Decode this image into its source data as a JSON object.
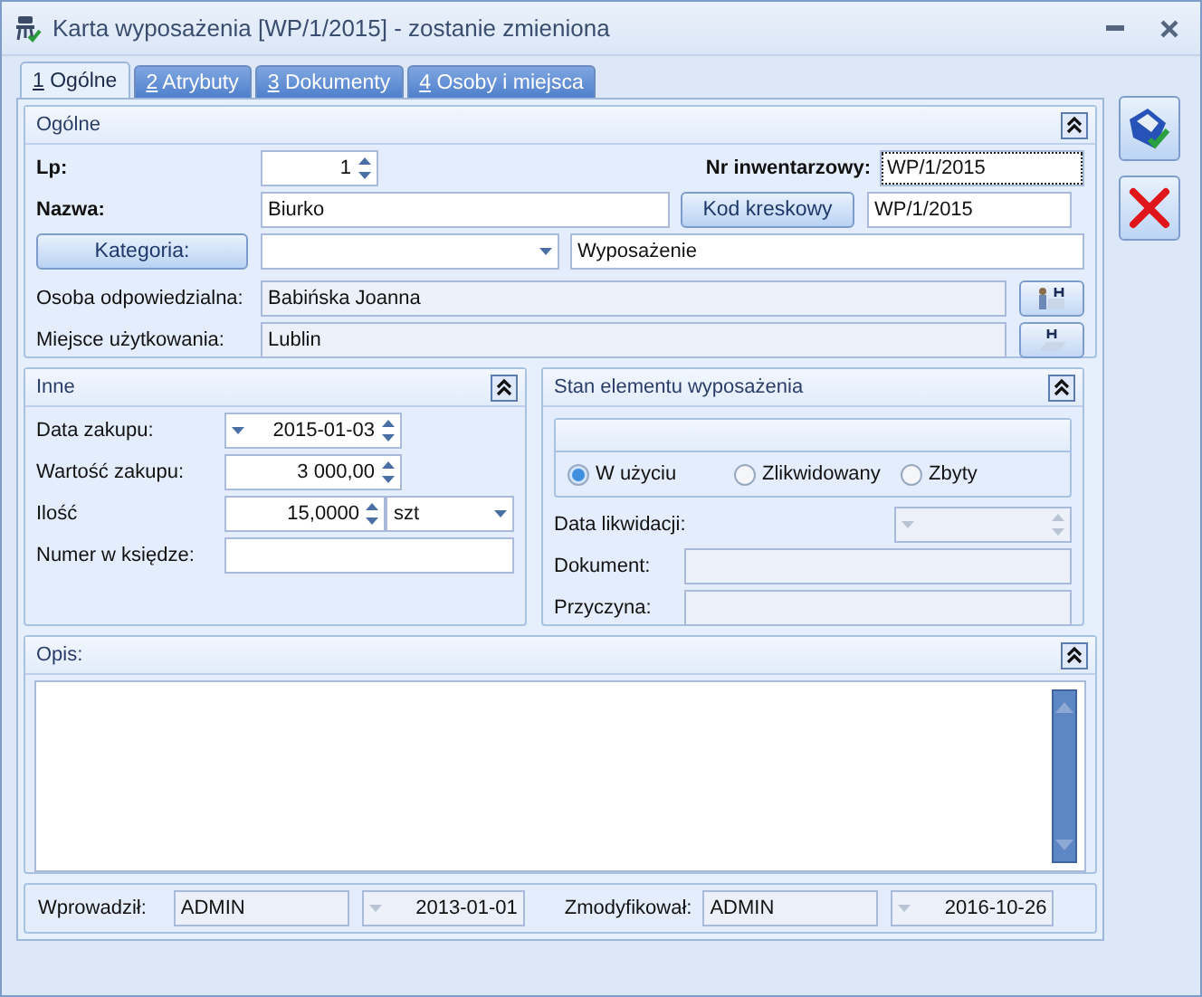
{
  "window": {
    "title": "Karta wyposażenia [WP/1/2015] - zostanie zmieniona"
  },
  "tabs": [
    {
      "key": "1",
      "label": "Ogólne",
      "selected": true
    },
    {
      "key": "2",
      "label": "Atrybuty",
      "selected": false
    },
    {
      "key": "3",
      "label": "Dokumenty",
      "selected": false
    },
    {
      "key": "4",
      "label": "Osoby i miejsca",
      "selected": false
    }
  ],
  "general": {
    "title": "Ogólne",
    "lp_label": "Lp:",
    "lp_value": "1",
    "inventory_label": "Nr inwentarzowy:",
    "inventory_value": "WP/1/2015",
    "name_label": "Nazwa:",
    "name_value": "Biurko",
    "barcode_button": "Kod kreskowy",
    "barcode_value": "WP/1/2015",
    "category_button": "Kategoria:",
    "category_name": "Wyposażenie",
    "person_label": "Osoba odpowiedzialna:",
    "person_value": "Babińska Joanna",
    "place_label": "Miejsce użytkowania:",
    "place_value": "Lublin"
  },
  "other": {
    "title": "Inne",
    "fields": [
      {
        "kind": "date",
        "label": "Data zakupu:",
        "value": "2015-01-03"
      },
      {
        "kind": "spin",
        "label": "Wartość zakupu:",
        "value": "3 000,00"
      },
      {
        "kind": "spin_unit",
        "label": "Ilość",
        "value": "15,0000",
        "unit": "szt"
      },
      {
        "kind": "text",
        "label": "Numer w księdze:"
      }
    ]
  },
  "status": {
    "title": "Stan elementu wyposażenia",
    "options": [
      {
        "label": "W użyciu",
        "selected": true
      },
      {
        "label": "Zlikwidowany",
        "selected": false
      },
      {
        "label": "Zbyty",
        "selected": false
      }
    ],
    "liquidation_label": "Data likwidacji:",
    "document_label": "Dokument:",
    "reason_label": "Przyczyna:"
  },
  "description": {
    "title": "Opis:"
  },
  "footer": {
    "created_label": "Wprowadził:",
    "created_by": "ADMIN",
    "created_date": "2013-01-01",
    "modified_label": "Zmodyfikował:",
    "modified_by": "ADMIN",
    "modified_date": "2016-10-26"
  }
}
